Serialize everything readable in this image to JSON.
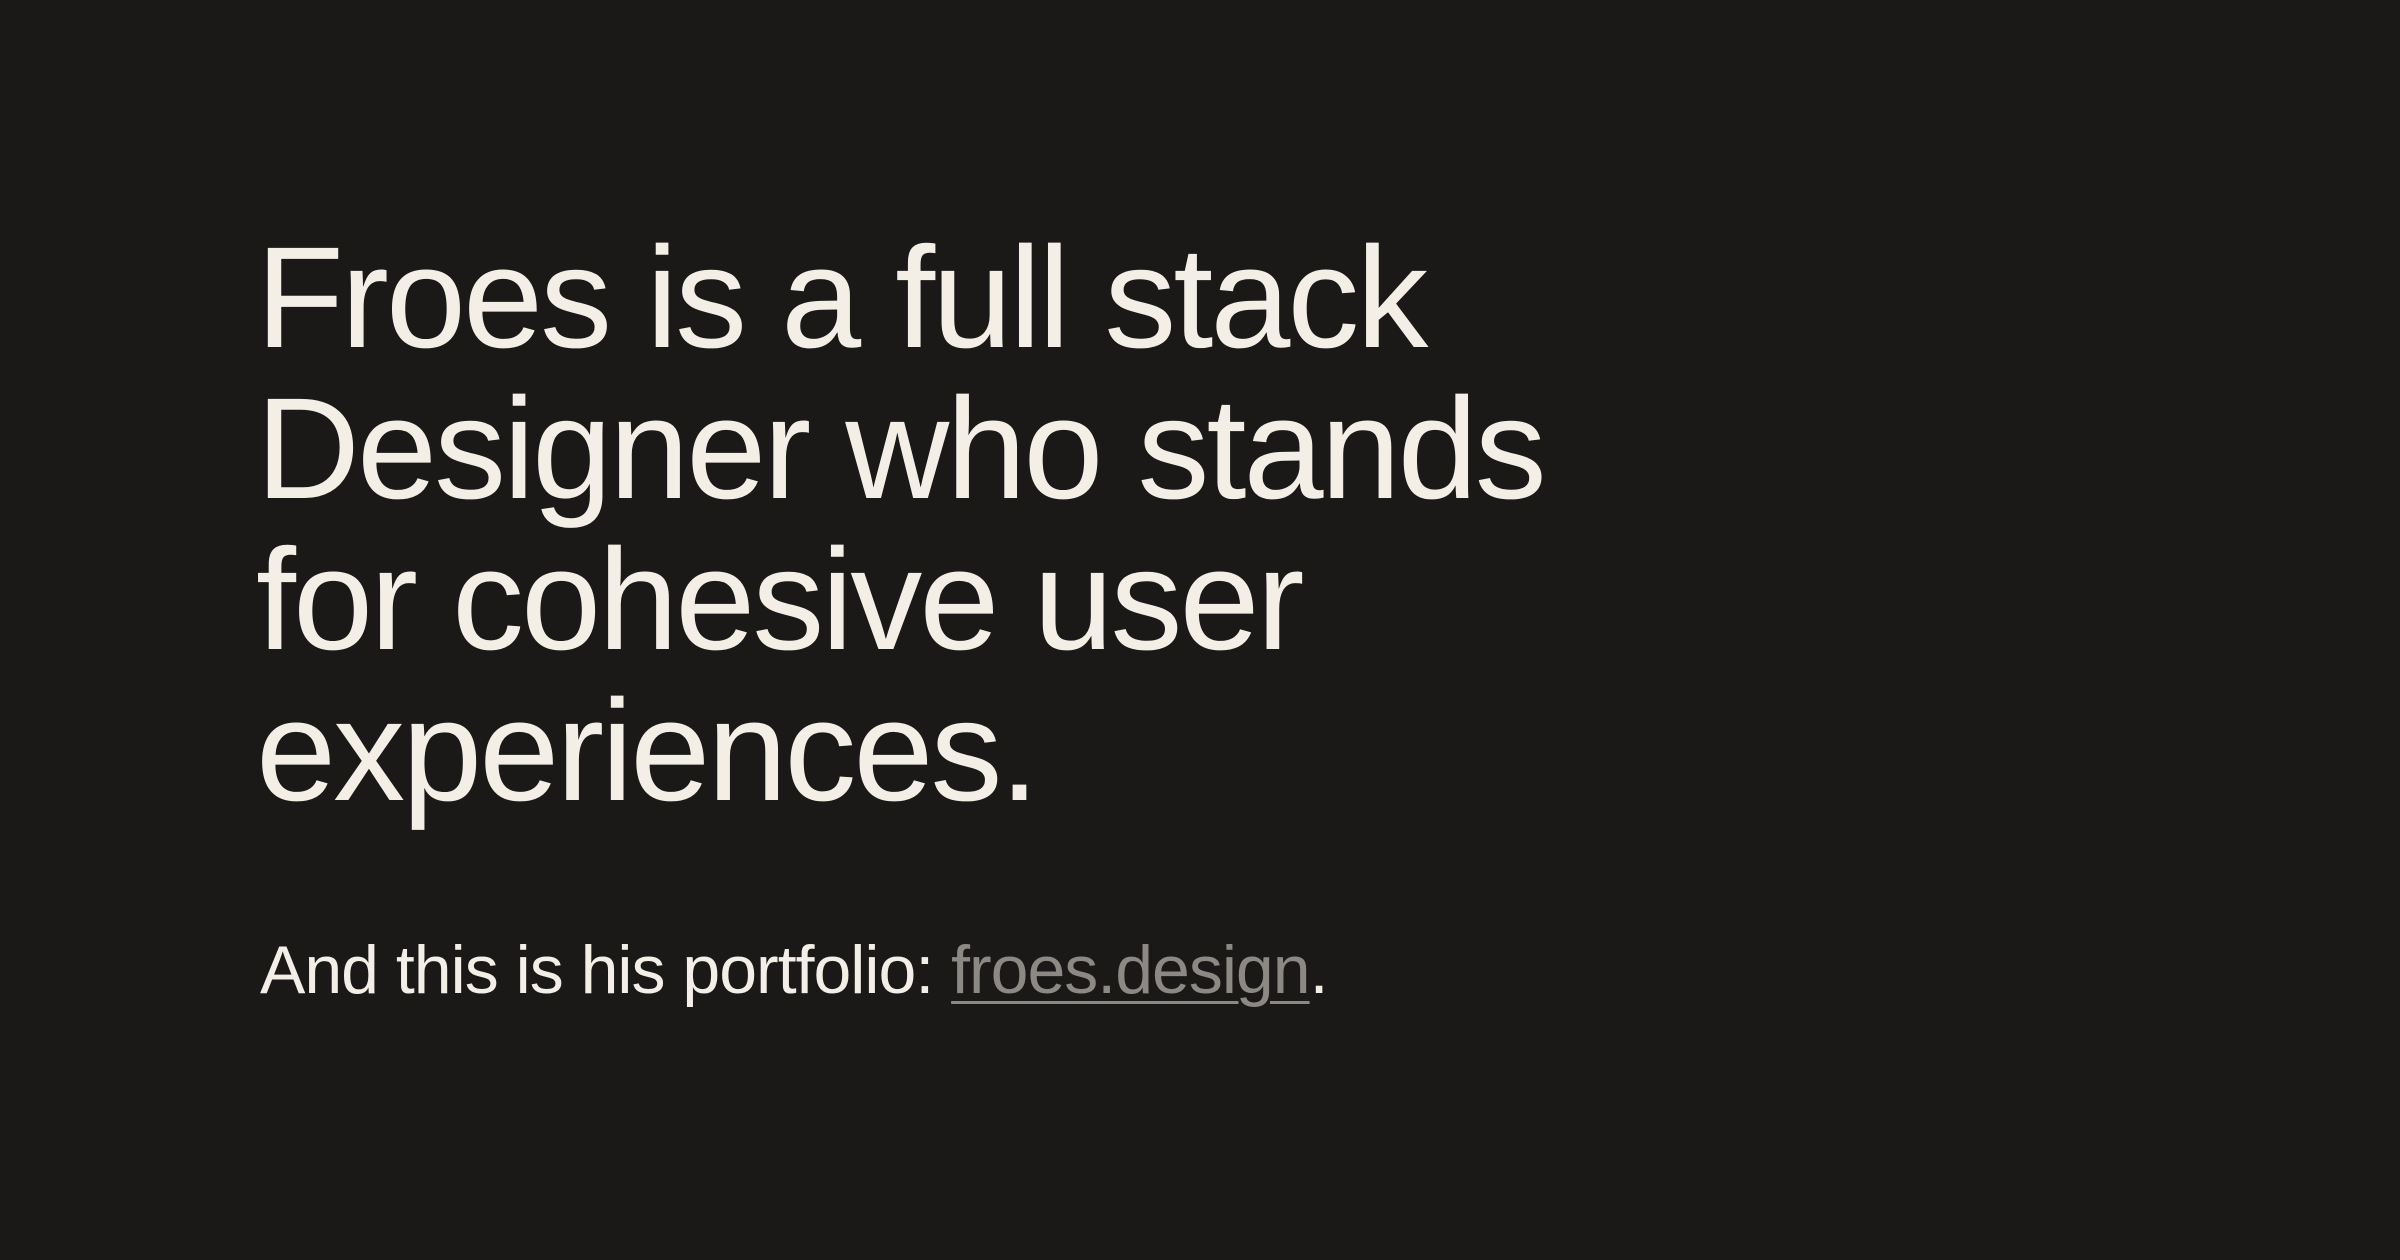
{
  "headline": {
    "lines": [
      "Froes is a full stack",
      "Designer who stands",
      "for cohesive user",
      "experiences."
    ]
  },
  "portfolio": {
    "prefix": "And this is his portfolio: ",
    "link_text": "froes.design",
    "suffix": "."
  },
  "colors": {
    "background": "#1b1918",
    "text": "#f3efe7",
    "link": "#8c8884"
  }
}
